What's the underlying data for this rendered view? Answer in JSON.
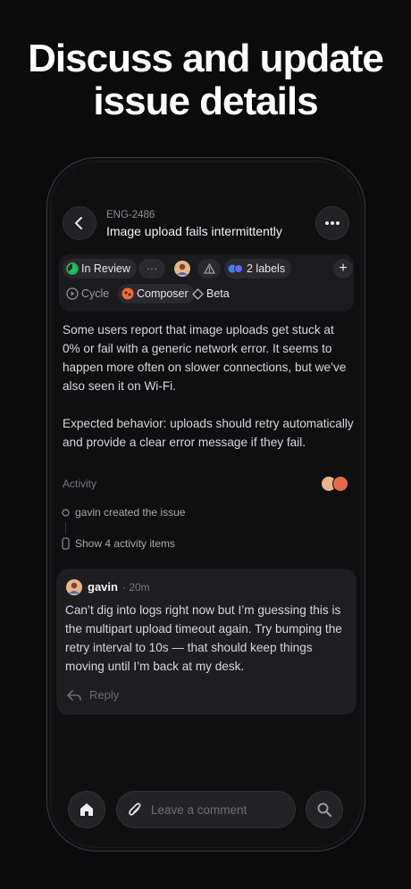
{
  "marketing": {
    "headline_line1": "Discuss and update",
    "headline_line2": "issue details"
  },
  "issue": {
    "id": "ENG-2486",
    "title": "Image upload fails intermittently"
  },
  "properties": {
    "status": "In Review",
    "status_color": "#22c55e",
    "priority": "···",
    "labels": "2 labels",
    "cycle": "Cycle",
    "project": "Composer",
    "project_color": "#f26b3a",
    "milestone": "Beta",
    "add": "+"
  },
  "description": {
    "paragraph1": "Some users report that image uploads get stuck at 0% or fail with a generic network error. It seems to happen more often on slower connections, but we’ve also seen it on Wi-Fi.",
    "paragraph2": "Expected behavior: uploads should retry automatically and provide a clear error message if they fail."
  },
  "activity": {
    "label": "Activity",
    "created": "gavin created the issue",
    "show_more": "Show 4 activity items"
  },
  "comment": {
    "author": "gavin",
    "time": "· 20m",
    "text": "Can’t dig into logs right now but I’m guessing this is the multipart upload timeout again. Try bumping the retry interval to 10s — that should keep things moving until I’m back at my desk.",
    "reply": "Reply"
  },
  "composer": {
    "placeholder": "Leave a comment"
  },
  "icons": {
    "back": "chevron-left-icon",
    "more": "ellipsis-icon",
    "home": "home-icon",
    "search": "search-icon",
    "attach": "paperclip-icon"
  }
}
